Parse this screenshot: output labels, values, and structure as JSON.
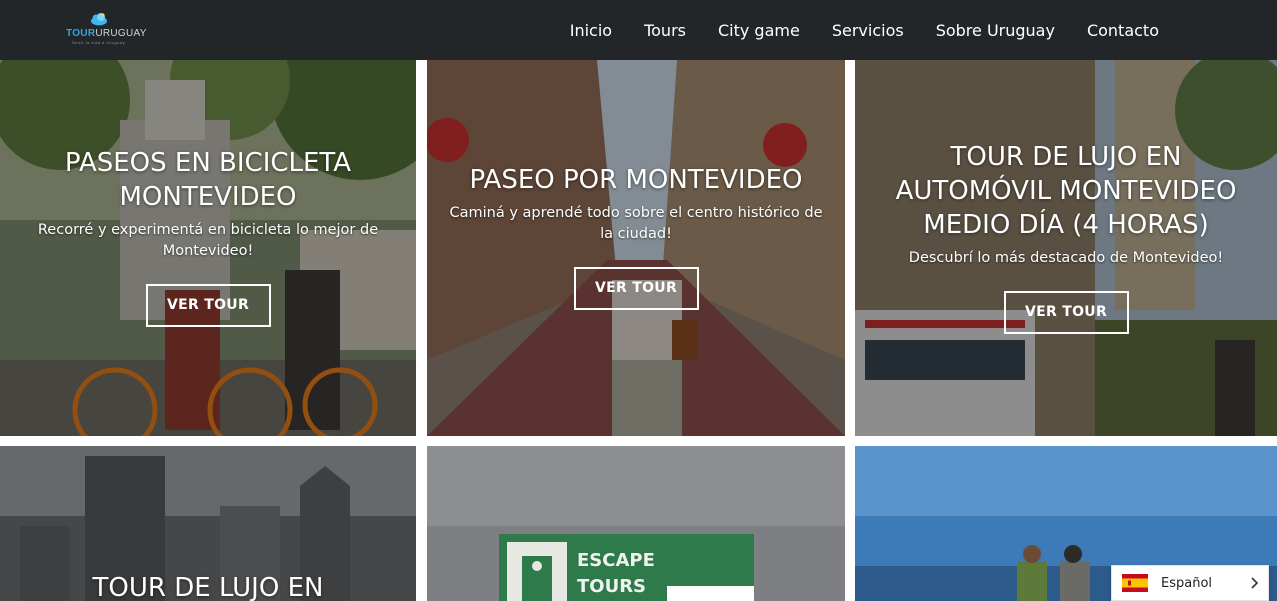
{
  "header": {
    "logo": {
      "text_primary": "TOUR",
      "text_secondary": "URUGUAY",
      "tagline": "Sentí la vida a Uruguay"
    },
    "nav": [
      "Inicio",
      "Tours",
      "City game",
      "Servicios",
      "Sobre Uruguay",
      "Contacto"
    ]
  },
  "cards": [
    {
      "title": "PASEOS EN BICICLETA MONTEVIDEO",
      "desc": "Recorré y experimentá en bicicleta lo mejor de Montevideo!",
      "button": "VER TOUR"
    },
    {
      "title": "PASEO POR MONTEVIDEO",
      "desc": "Caminá y aprendé todo sobre el centro histórico de la ciudad!",
      "button": "VER TOUR"
    },
    {
      "title": "TOUR DE LUJO EN AUTOMÓVIL MONTEVIDEO MEDIO DÍA (4 HORAS)",
      "desc": "Descubrí lo más destacado de Montevideo!",
      "button": "VER TOUR"
    },
    {
      "title": "TOUR DE LUJO EN"
    },
    {
      "sign_line1": "ESCAPE",
      "sign_line2": "TOURS"
    },
    {}
  ],
  "language": {
    "label": "Español",
    "flag_icon": "spain-flag-icon"
  },
  "colors": {
    "header_bg": "#222629",
    "logo_accent": "#2ea8e0",
    "card_text": "#ffffff"
  }
}
